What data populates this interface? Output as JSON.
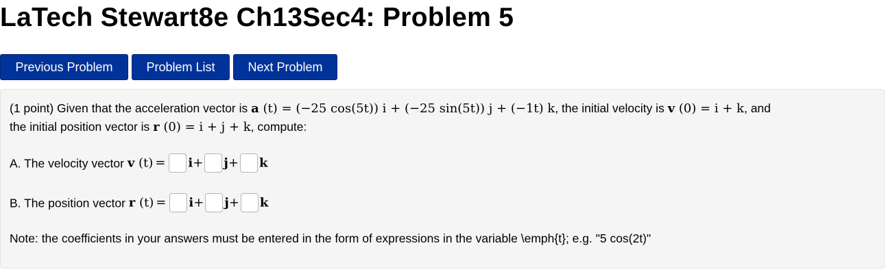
{
  "page_title": "LaTech Stewart8e Ch13Sec4: Problem 5",
  "nav": {
    "previous": "Previous Problem",
    "list": "Problem List",
    "next": "Next Problem"
  },
  "colors": {
    "button_bg": "#003399",
    "button_text": "#ffffff",
    "panel_bg": "#f5f5f5"
  },
  "problem": {
    "intro_1": "(1 point) Given that the acceleration vector is ",
    "accel_lhs": "a",
    "accel_expr": " (t) = (−25 cos(5t)) i + (−25 sin(5t)) j + (−1t) k",
    "intro_2": ", the initial velocity is ",
    "vel_lhs": "v",
    "vel_expr": " (0) = i + k",
    "intro_3": ", and",
    "line2_a": "the initial position vector is ",
    "pos_lhs": "r",
    "pos_expr": " (0) = i + j + k",
    "line2_b": ", compute:",
    "part_a_label": "A. The velocity vector ",
    "part_a_var": "v",
    "part_a_arg": " (t)",
    "part_b_label": "B. The position vector ",
    "part_b_var": "r",
    "part_b_arg": " (t)",
    "equals": "=",
    "unit_i": "i",
    "unit_j": "j",
    "unit_k": "k",
    "plus": "+",
    "note": "Note: the coefficients in your answers must be entered in the form of expressions in the variable \\emph{t}; e.g. \"5 cos(2t)\""
  },
  "answers": {
    "a_i": "",
    "a_j": "",
    "a_k": "",
    "b_i": "",
    "b_j": "",
    "b_k": ""
  }
}
